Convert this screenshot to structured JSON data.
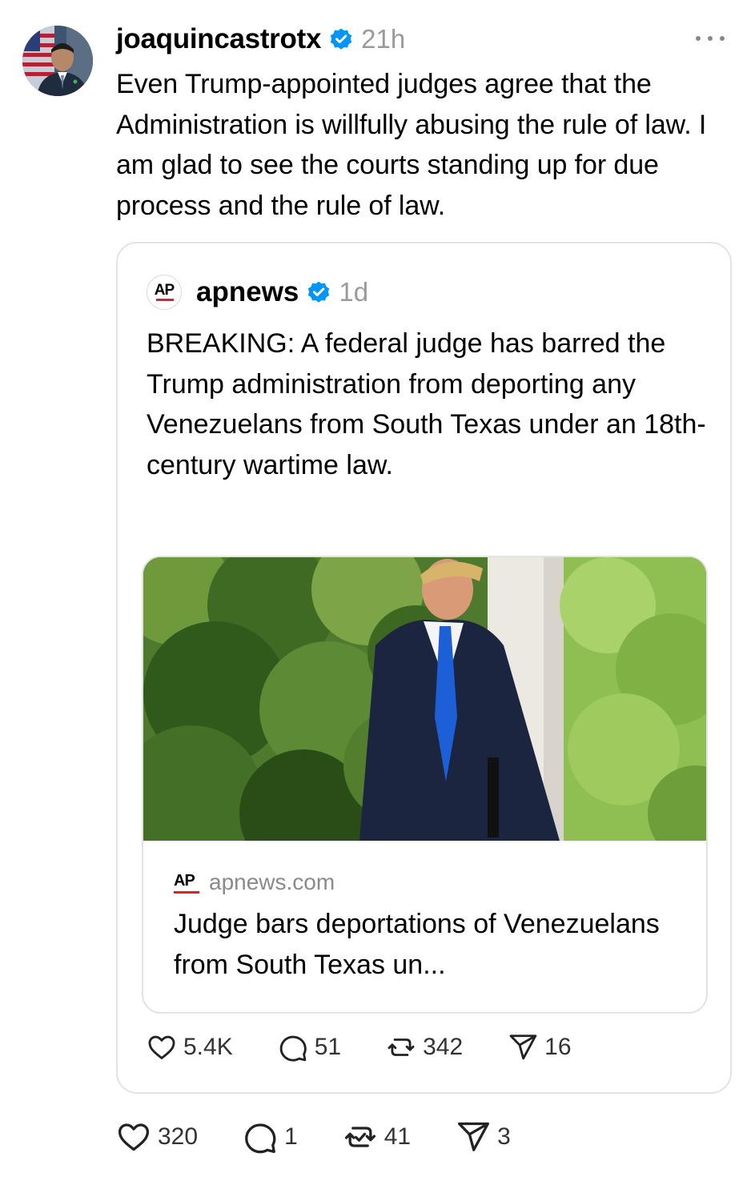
{
  "post": {
    "username": "joaquincastrotx",
    "timestamp": "21h",
    "body": "Even Trump-appointed judges agree that the Administration is willfully abusing the rule of law. I am glad to see the courts standing up for due process and the rule of law.",
    "actions": {
      "likes": "320",
      "replies": "1",
      "reposts": "41",
      "shares": "3"
    }
  },
  "quote": {
    "username": "apnews",
    "timestamp": "1d",
    "logo_text": "AP",
    "body": "BREAKING: A federal judge has barred the Trump administration from deporting any Venezuelans from South Texas under an 18th-century wartime law.",
    "link": {
      "logo_text": "AP",
      "domain": "apnews.com",
      "title": "Judge bars deportations of Venezuelans from South Texas un..."
    },
    "actions": {
      "likes": "5.4K",
      "replies": "51",
      "reposts": "342",
      "shares": "16"
    }
  },
  "icons": {
    "verified": "verified-badge-icon",
    "more": "more-options-icon",
    "like": "heart-icon",
    "reply": "comment-icon",
    "repost": "repost-icon",
    "share": "send-icon"
  },
  "colors": {
    "verified": "#0095f6",
    "ap_red": "#e01f26",
    "muted": "#9a9a9a"
  }
}
